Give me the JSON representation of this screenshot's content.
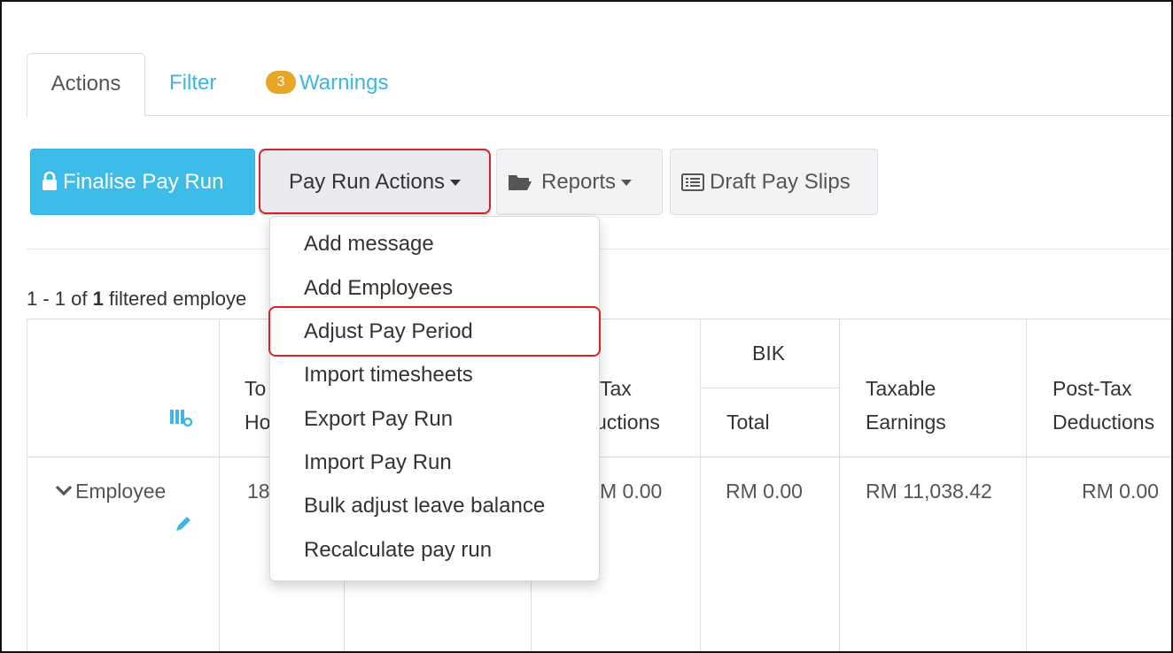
{
  "tabs": {
    "actions": "Actions",
    "filter": "Filter",
    "warnings_count": "3",
    "warnings": "Warnings"
  },
  "toolbar": {
    "finalise": "Finalise Pay Run",
    "pay_run_actions": "Pay Run Actions",
    "reports": "Reports",
    "draft_pay_slips": "Draft Pay Slips"
  },
  "count": {
    "range": "1 - 1 of ",
    "total": "1",
    "suffix": " filtered employe"
  },
  "menu": {
    "items": [
      "Add message",
      "Add Employees",
      "Adjust Pay Period",
      "Import timesheets",
      "Export Pay Run",
      "Import Pay Run",
      "Bulk adjust leave balance",
      "Recalculate pay run"
    ]
  },
  "table": {
    "headers": {
      "total_hours_1": "To",
      "total_hours_2": "Ho",
      "tax_1": "Tax",
      "tax_2": "uctions",
      "bik": "BIK",
      "bik_total": "Total",
      "taxable_1": "Taxable",
      "taxable_2": "Earnings",
      "posttax_1": "Post-Tax",
      "posttax_2": "Deductions"
    },
    "row": {
      "employee": "Employee",
      "hours": "18",
      "tax": "M 0.00",
      "bik": "RM 0.00",
      "taxable": "RM 11,038.42",
      "posttax": "RM 0.00"
    }
  },
  "colors": {
    "accent": "#3ebce9",
    "badge": "#e8a626",
    "highlight": "#d9222a"
  }
}
